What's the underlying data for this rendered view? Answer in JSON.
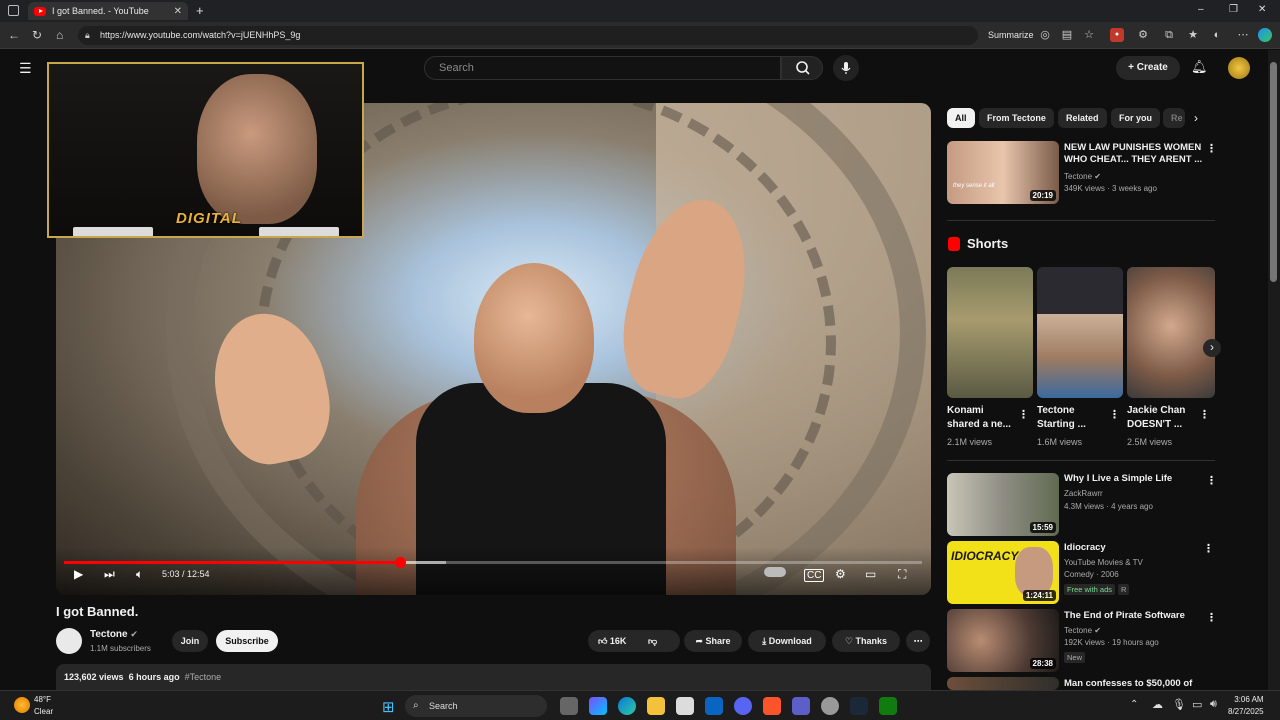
{
  "browser": {
    "tab_title": "I got Banned. - YouTube",
    "url": "https://www.youtube.com/watch?v=jUENHhPS_9g",
    "summarize_label": "Summarize"
  },
  "masthead": {
    "search_placeholder": "Search",
    "create_label": "Create"
  },
  "player": {
    "time_current_total": "5:03 / 12:54",
    "progress_fraction": 0.392,
    "buffered_fraction": 0.445,
    "overlay_logo_text": "DIGITAL"
  },
  "video": {
    "title": "I got Banned.",
    "channel_name": "Tectone",
    "subscribers": "1.1M subscribers",
    "join_label": "Join",
    "subscribe_label": "Subscribe",
    "likes": "16K",
    "share_label": "Share",
    "download_label": "Download",
    "thanks_label": "Thanks",
    "views": "123,602 views",
    "age": "6 hours ago",
    "hashtag": "#Tectone"
  },
  "chips": [
    "All",
    "From Tectone",
    "Related",
    "For you",
    "Re"
  ],
  "recommended_top": {
    "title_line1": "NEW LAW PUNISHES WOMEN",
    "title_line2": "WHO CHEAT... THEY ARENT ...",
    "channel": "Tectone",
    "meta": "349K views · 3 weeks ago",
    "duration": "20:19",
    "thumb_caption": "they sense it all"
  },
  "shorts": {
    "heading": "Shorts",
    "items": [
      {
        "title_line1": "Konami",
        "title_line2": "shared a ne...",
        "views": "2.1M views"
      },
      {
        "title_line1": "Tectone",
        "title_line2": "Starting ...",
        "views": "1.6M views"
      },
      {
        "title_line1": "Jackie Chan",
        "title_line2": "DOESN'T ...",
        "views": "2.5M views"
      }
    ]
  },
  "recommended": [
    {
      "title": "Why I Live a Simple Life",
      "channel": "ZackRawrr",
      "meta": "4.3M views · 4 years ago",
      "duration": "15:59"
    },
    {
      "title": "Idiocracy",
      "channel": "YouTube Movies & TV",
      "meta": "Comedy · 2006",
      "badge1": "Free with ads",
      "badge2": "R",
      "duration": "1:24:11",
      "thumb_text": "IDIOCRACY"
    },
    {
      "title": "The End of Pirate Software",
      "channel": "Tectone",
      "meta": "192K views · 19 hours ago",
      "badge1": "New",
      "duration": "28:38"
    },
    {
      "title": "Man confesses to $50,000 of"
    }
  ],
  "taskbar": {
    "weather_temp": "48°F",
    "weather_cond": "Clear",
    "search_label": "Search",
    "time": "3:06 AM",
    "date": "8/27/2025"
  },
  "colors": {
    "accent_red": "#ff0000",
    "background": "#0f0f0f",
    "chip": "#272727"
  }
}
